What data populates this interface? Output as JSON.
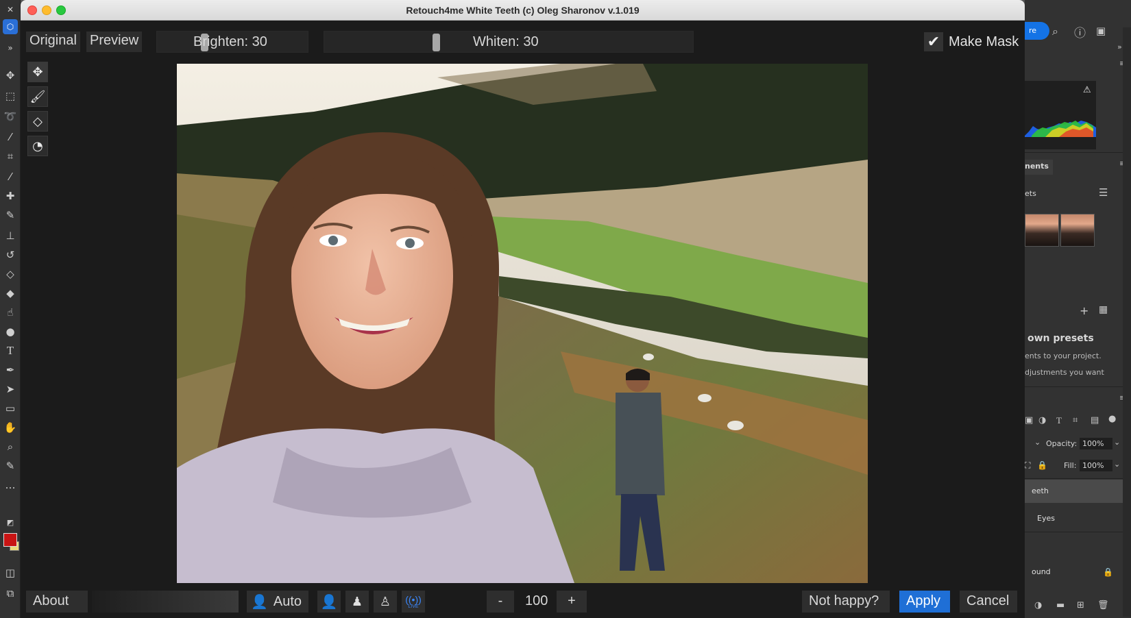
{
  "window": {
    "title": "Retouch4me White Teeth (c) Oleg Sharonov v.1.019"
  },
  "top_controls": {
    "original_label": "Original",
    "preview_label": "Preview",
    "brighten_label": "Brighten: 30",
    "brighten_value": 30,
    "whiten_label": "Whiten: 30",
    "whiten_value": 30,
    "make_mask_label": "Make Mask",
    "make_mask_checked": true
  },
  "tools": [
    "move-icon",
    "brush-icon",
    "eraser-icon",
    "color-picker-icon"
  ],
  "bottom_bar": {
    "about_label": "About",
    "auto_label": "Auto",
    "zoom_minus": "-",
    "zoom_value": "100",
    "zoom_plus": "+",
    "not_happy_label": "Not happy?",
    "apply_label": "Apply",
    "cancel_label": "Cancel",
    "live_label": "LIVE"
  },
  "ps_right": {
    "share_label": "re",
    "adjustments_tab": "nents",
    "presets_label": "ets",
    "own_presets_title": "own presets",
    "own_presets_line1": "ents to your project.",
    "own_presets_line2": "djustments you want",
    "opacity_label": "Opacity:",
    "opacity_value": "100%",
    "fill_label": "Fill:",
    "fill_value": "100%",
    "layers": [
      "eeth",
      "Eyes",
      "ound"
    ]
  },
  "colors": {
    "accent": "#1f6fd6",
    "foreground_swatch": "#c81414",
    "background_swatch": "#e8d87a"
  }
}
